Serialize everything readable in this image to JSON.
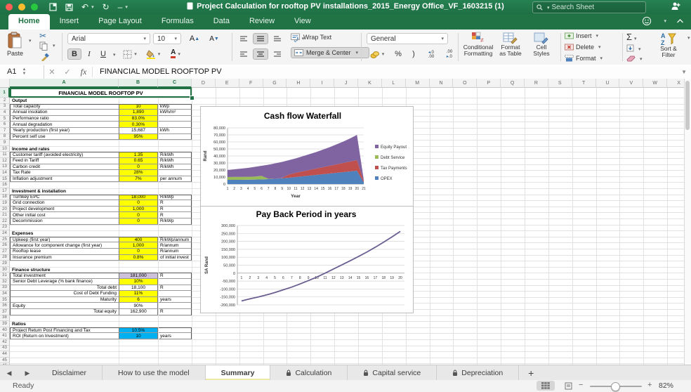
{
  "titlebar": {
    "title": "Project Calculation for rooftop PV installations_2015_Energy Office_VF_1603215 (1)",
    "search_placeholder": "Search Sheet"
  },
  "menu": {
    "tabs": [
      "Home",
      "Insert",
      "Page Layout",
      "Formulas",
      "Data",
      "Review",
      "View"
    ],
    "active": "Home"
  },
  "ribbon": {
    "paste": "Paste",
    "font_name": "Arial",
    "font_size": "10",
    "bold": "B",
    "italic": "I",
    "underline": "U",
    "wrap_text": "Wrap Text",
    "merge_center": "Merge & Center",
    "number_format": "General",
    "conditional_formatting_1": "Conditional",
    "conditional_formatting_2": "Formatting",
    "format_as_table_1": "Format",
    "format_as_table_2": "as Table",
    "cell_styles_1": "Cell",
    "cell_styles_2": "Styles",
    "insert": "Insert",
    "delete": "Delete",
    "format": "Format",
    "sort_filter_1": "Sort &",
    "sort_filter_2": "Filter"
  },
  "formula_bar": {
    "cell_ref": "A1",
    "function_label": "fx",
    "content": "FINANCIAL MODEL ROOFTOP PV"
  },
  "sheet": {
    "row_count": 46,
    "title_cell": "FINANCIAL MODEL ROOFTOP PV",
    "rows": [
      {
        "n": 2,
        "label": "Output",
        "header": true
      },
      {
        "n": 3,
        "label": "Total capacity",
        "value": "10",
        "unit": "kWp",
        "fill": "yellow",
        "top": true
      },
      {
        "n": 4,
        "label": "Annual insolation",
        "value": "1,890",
        "unit": "kWh/m²",
        "fill": "yellow"
      },
      {
        "n": 5,
        "label": "Performance ratio",
        "value": "83.0%",
        "unit": "",
        "fill": "yellow"
      },
      {
        "n": 6,
        "label": "Annual degradation",
        "value": "0.30%",
        "unit": "",
        "fill": "yellow"
      },
      {
        "n": 7,
        "label": "Yearly production (first year)",
        "value": "15,687",
        "unit": "kWh",
        "fill": "white"
      },
      {
        "n": 8,
        "label": "Percent self use",
        "value": "95%",
        "unit": "",
        "fill": "yellow"
      },
      {
        "n": 10,
        "label": "Income and rates",
        "header": true
      },
      {
        "n": 11,
        "label": "Customer tariff (avoided electricity)",
        "value": "1.35",
        "unit": "R/kWh",
        "fill": "yellow",
        "top": true
      },
      {
        "n": 12,
        "label": "Feed in Tariff",
        "value": "0.65",
        "unit": "R/kWh",
        "fill": "yellow"
      },
      {
        "n": 13,
        "label": "Carbon credit",
        "value": "0",
        "unit": "R/kWh",
        "fill": "yellow"
      },
      {
        "n": 14,
        "label": "Tax Rate",
        "value": "28%",
        "unit": "",
        "fill": "yellow"
      },
      {
        "n": 15,
        "label": "Inflation adjustment",
        "value": "7%",
        "unit": "per annum",
        "fill": "yellow"
      },
      {
        "n": 17,
        "label": "Investment & installation",
        "header": true
      },
      {
        "n": 18,
        "label": "Turnkey EPC",
        "value": "18,000",
        "unit": "R/kWp",
        "fill": "yellow",
        "top": true
      },
      {
        "n": 19,
        "label": "Grid connection",
        "value": "0",
        "unit": "R",
        "fill": "yellow"
      },
      {
        "n": 20,
        "label": "Project development",
        "value": "1,000",
        "unit": "R",
        "fill": "yellow"
      },
      {
        "n": 21,
        "label": "Other initial cost",
        "value": "0",
        "unit": "R",
        "fill": "yellow"
      },
      {
        "n": 22,
        "label": "Decommission",
        "value": "0",
        "unit": "R/kWp",
        "fill": "yellow"
      },
      {
        "n": 24,
        "label": "Expenses",
        "header": true
      },
      {
        "n": 25,
        "label": "Upkeep (first year)",
        "value": "400",
        "unit": "R/kWp/annum",
        "fill": "yellow",
        "top": true
      },
      {
        "n": 26,
        "label": "Allowance for component change (first year)",
        "value": "1,000",
        "unit": "R/annum",
        "fill": "yellow"
      },
      {
        "n": 27,
        "label": "Rooftop lease",
        "value": "0",
        "unit": "R/annum",
        "fill": "yellow"
      },
      {
        "n": 28,
        "label": "Insurance premium",
        "value": "0.8%",
        "unit": "of initial invest",
        "fill": "yellow"
      },
      {
        "n": 30,
        "label": "Finance structure",
        "header": true
      },
      {
        "n": 31,
        "label": "Total investment",
        "value": "181,000",
        "unit": "R",
        "fill": "lavender",
        "top": true
      },
      {
        "n": 32,
        "label": "Senior Debt Leverage (% bank finance)",
        "value": "10%",
        "unit": "",
        "fill": "yellow"
      },
      {
        "n": 33,
        "label": "Total debt",
        "value": "18,100",
        "unit": "R",
        "fill": "white",
        "align": "right"
      },
      {
        "n": 34,
        "label": "Cost of Debt Funding",
        "value": "11%",
        "unit": "",
        "fill": "yellow",
        "align": "right"
      },
      {
        "n": 35,
        "label": "Maturity",
        "value": "6",
        "unit": "years",
        "fill": "yellow",
        "align": "right"
      },
      {
        "n": 36,
        "label": "Equity",
        "value": "90%",
        "unit": "",
        "fill": "white"
      },
      {
        "n": 37,
        "label": "Total equity",
        "value": "162,900",
        "unit": "R",
        "fill": "white",
        "align": "right"
      },
      {
        "n": 39,
        "label": "Ratios",
        "header": true
      },
      {
        "n": 40,
        "label": "Project Return Post Financing and Tax",
        "value": "10.5%",
        "unit": "",
        "fill": "cyan",
        "top": true
      },
      {
        "n": 41,
        "label": "ROI (Return on Investment)",
        "value": "10",
        "unit": "years",
        "fill": "cyan"
      }
    ],
    "fills": {
      "yellow": "#ffff00",
      "lavender": "#ccc0da",
      "cyan": "#00b0f0",
      "white": "#ffffff"
    }
  },
  "chart_data": [
    {
      "type": "area",
      "title": "Cash flow Waterfall",
      "xlabel": "Year",
      "ylabel": "Rand",
      "x": [
        1,
        2,
        3,
        4,
        5,
        6,
        7,
        8,
        9,
        10,
        11,
        12,
        13,
        14,
        15,
        16,
        17,
        18,
        19,
        20,
        21
      ],
      "ylim": [
        0,
        80000
      ],
      "ytick": 10000,
      "grid": true,
      "legend_position": "right",
      "series": [
        {
          "name": "OPEX",
          "color": "#4f81bd",
          "values": [
            6000,
            6000,
            6000,
            6200,
            6400,
            6600,
            7000,
            7500,
            8200,
            9000,
            10000,
            11000,
            12000,
            13000,
            14000,
            15000,
            16000,
            17000,
            18000,
            19000,
            2500
          ]
        },
        {
          "name": "Tax Payments",
          "color": "#c0504d",
          "values": [
            0,
            0,
            0,
            0,
            0,
            0,
            0,
            0,
            500,
            4500,
            6000,
            7000,
            8000,
            9000,
            10000,
            11000,
            12000,
            13000,
            14000,
            15000,
            2000
          ]
        },
        {
          "name": "Debt Service",
          "color": "#9bbb59",
          "values": [
            4000,
            4200,
            4200,
            4200,
            4200,
            5000,
            500,
            0,
            0,
            0,
            0,
            0,
            0,
            0,
            0,
            0,
            0,
            0,
            0,
            0,
            0
          ]
        },
        {
          "name": "Equity Payout",
          "color": "#8064a2",
          "values": [
            10000,
            10800,
            11800,
            12600,
            13900,
            14400,
            20000,
            22000,
            22800,
            20500,
            20500,
            21500,
            22500,
            23500,
            25000,
            26500,
            28500,
            30500,
            33000,
            36000,
            1500
          ]
        }
      ],
      "legend_order": [
        "Equity Payout",
        "Debt Service",
        "Tax Payments",
        "OPEX"
      ]
    },
    {
      "type": "line",
      "title": "Pay Back Period in years",
      "xlabel": "",
      "ylabel": "SA Rand",
      "x": [
        1,
        2,
        3,
        4,
        5,
        6,
        7,
        8,
        9,
        10,
        11,
        12,
        13,
        14,
        15,
        16,
        17,
        18,
        19,
        20
      ],
      "ylim": [
        -200000,
        300000
      ],
      "ytick": 50000,
      "grid": true,
      "line_color": "#6a5e91",
      "values": [
        -175000,
        -162000,
        -150000,
        -137000,
        -122000,
        -105000,
        -88000,
        -68000,
        -47000,
        -25000,
        0,
        26000,
        52000,
        78000,
        105000,
        133000,
        163000,
        195000,
        228000,
        263000
      ]
    }
  ],
  "sheet_tabs": {
    "items": [
      {
        "label": "Disclaimer",
        "locked": false,
        "active": false
      },
      {
        "label": "How to use the model",
        "locked": false,
        "active": false
      },
      {
        "label": "Summary",
        "locked": false,
        "active": true
      },
      {
        "label": "Calculation",
        "locked": true,
        "active": false
      },
      {
        "label": "Capital service",
        "locked": true,
        "active": false
      },
      {
        "label": "Depreciation",
        "locked": true,
        "active": false
      }
    ],
    "add_label": "+"
  },
  "status_bar": {
    "ready": "Ready",
    "zoom_level": "82%"
  },
  "colors": {
    "accent": "#217346",
    "selection": "#217346"
  }
}
